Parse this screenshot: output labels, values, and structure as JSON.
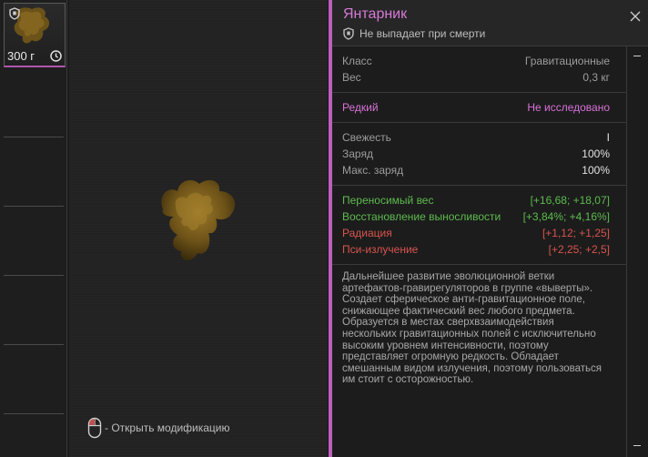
{
  "inventory": {
    "slot1": {
      "weight": "300 г",
      "icon_top": "shield-icon",
      "icon_bottom": "clock-icon"
    }
  },
  "preview": {
    "hint": "- Открыть модификацию",
    "hint_icon": "mouse-icon"
  },
  "panel": {
    "title": "Янтарник",
    "subtitle": "Не выпадает при смерти",
    "accent": "#bd5fbd",
    "stats": [
      {
        "label": "Класс",
        "value": "Гравитационные"
      },
      {
        "label": "Вес",
        "value": "0,3 кг"
      }
    ],
    "rarity": {
      "label": "Редкий",
      "value": "Не исследовано"
    },
    "condition": [
      {
        "label": "Свежесть",
        "value": "I"
      },
      {
        "label": "Заряд",
        "value": "100%"
      },
      {
        "label": "Макс. заряд",
        "value": "100%"
      }
    ],
    "effects": [
      {
        "label": "Переносимый вес",
        "value": "[+16,68; +18,07]",
        "color": "#5dbb4e"
      },
      {
        "label": "Восстановление выносливости",
        "value": "[+3,84%; +4,16%]",
        "color": "#5dbb4e"
      },
      {
        "label": "Радиация",
        "value": "[+1,12; +1,25]",
        "color": "#d9544e"
      },
      {
        "label": "Пси-излучение",
        "value": "[+2,25; +2,5]",
        "color": "#d9544e"
      }
    ],
    "description": "Дальнейшее развитие эволюционной ветки артефактов-гравирегуляторов в группе «выверты». Создает сферическое анти-гравитационное поле, снижающее фактический вес любого предмета. Образуется в местах сверхвзаимодействия нескольких гравитационных полей с исключительно высоким уровнем интенсивности, поэтому представляет огромную редкость. Обладает смешанным видом излучения, поэтому пользоваться им стоит с осторожностью."
  }
}
